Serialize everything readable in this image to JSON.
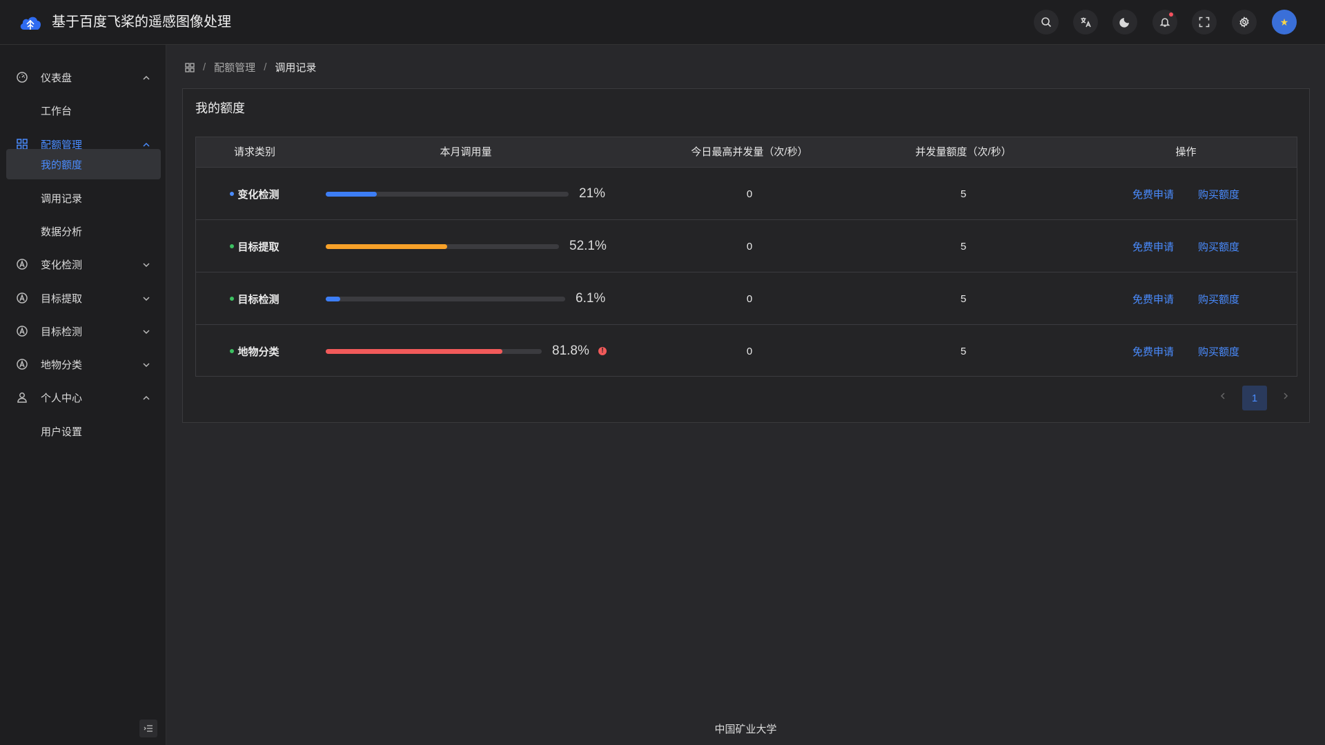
{
  "header": {
    "title": "基于百度飞桨的遥感图像处理",
    "icons": [
      "search-icon",
      "translate-icon",
      "moon-icon",
      "bell-icon",
      "fullscreen-icon",
      "gear-icon"
    ],
    "avatar_glyph": "★"
  },
  "sidebar": {
    "items": [
      {
        "label": "仪表盘",
        "icon": "dashboard-icon",
        "expanded": true
      },
      {
        "label": "工作台"
      },
      {
        "label": "配额管理",
        "icon": "grid-icon",
        "expanded": true
      },
      {
        "label": "我的额度"
      },
      {
        "label": "调用记录"
      },
      {
        "label": "数据分析"
      },
      {
        "label": "变化检测",
        "icon": "aperture-icon",
        "expanded": false
      },
      {
        "label": "目标提取",
        "icon": "aperture-icon",
        "expanded": false
      },
      {
        "label": "目标检测",
        "icon": "aperture-icon",
        "expanded": false
      },
      {
        "label": "地物分类",
        "icon": "aperture-icon",
        "expanded": false
      },
      {
        "label": "个人中心",
        "icon": "user-icon",
        "expanded": true
      },
      {
        "label": "用户设置"
      }
    ]
  },
  "breadcrumb": {
    "items": [
      "配额管理",
      "调用记录"
    ],
    "separator": "/"
  },
  "card": {
    "title": "我的额度"
  },
  "table": {
    "columns": [
      "请求类别",
      "本月调用量",
      "今日最高并发量（次/秒）",
      "并发量额度（次/秒）",
      "操作"
    ],
    "rows": [
      {
        "category": "变化检测",
        "dot_color": "#4a8cff",
        "usage_text": "21%",
        "usage_percent": 21,
        "bar_color": "#3d7ef5",
        "peak": "0",
        "quota": "5",
        "action1": "免费申请",
        "action2": "购买额度",
        "warn": false
      },
      {
        "category": "目标提取",
        "dot_color": "#3cc061",
        "usage_text": "52.1%",
        "usage_percent": 52.1,
        "bar_color": "#f7a129",
        "peak": "0",
        "quota": "5",
        "action1": "免费申请",
        "action2": "购买额度",
        "warn": false
      },
      {
        "category": "目标检测",
        "dot_color": "#3cc061",
        "usage_text": "6.1%",
        "usage_percent": 6.1,
        "bar_color": "#3d7ef5",
        "peak": "0",
        "quota": "5",
        "action1": "免费申请",
        "action2": "购买额度",
        "warn": false
      },
      {
        "category": "地物分类",
        "dot_color": "#3cc061",
        "usage_text": "81.8%",
        "usage_percent": 81.8,
        "bar_color": "#f25a5a",
        "peak": "0",
        "quota": "5",
        "action1": "免费申请",
        "action2": "购买额度",
        "warn": true
      }
    ]
  },
  "pagination": {
    "current": "1"
  },
  "footer": {
    "text": "中国矿业大学"
  }
}
